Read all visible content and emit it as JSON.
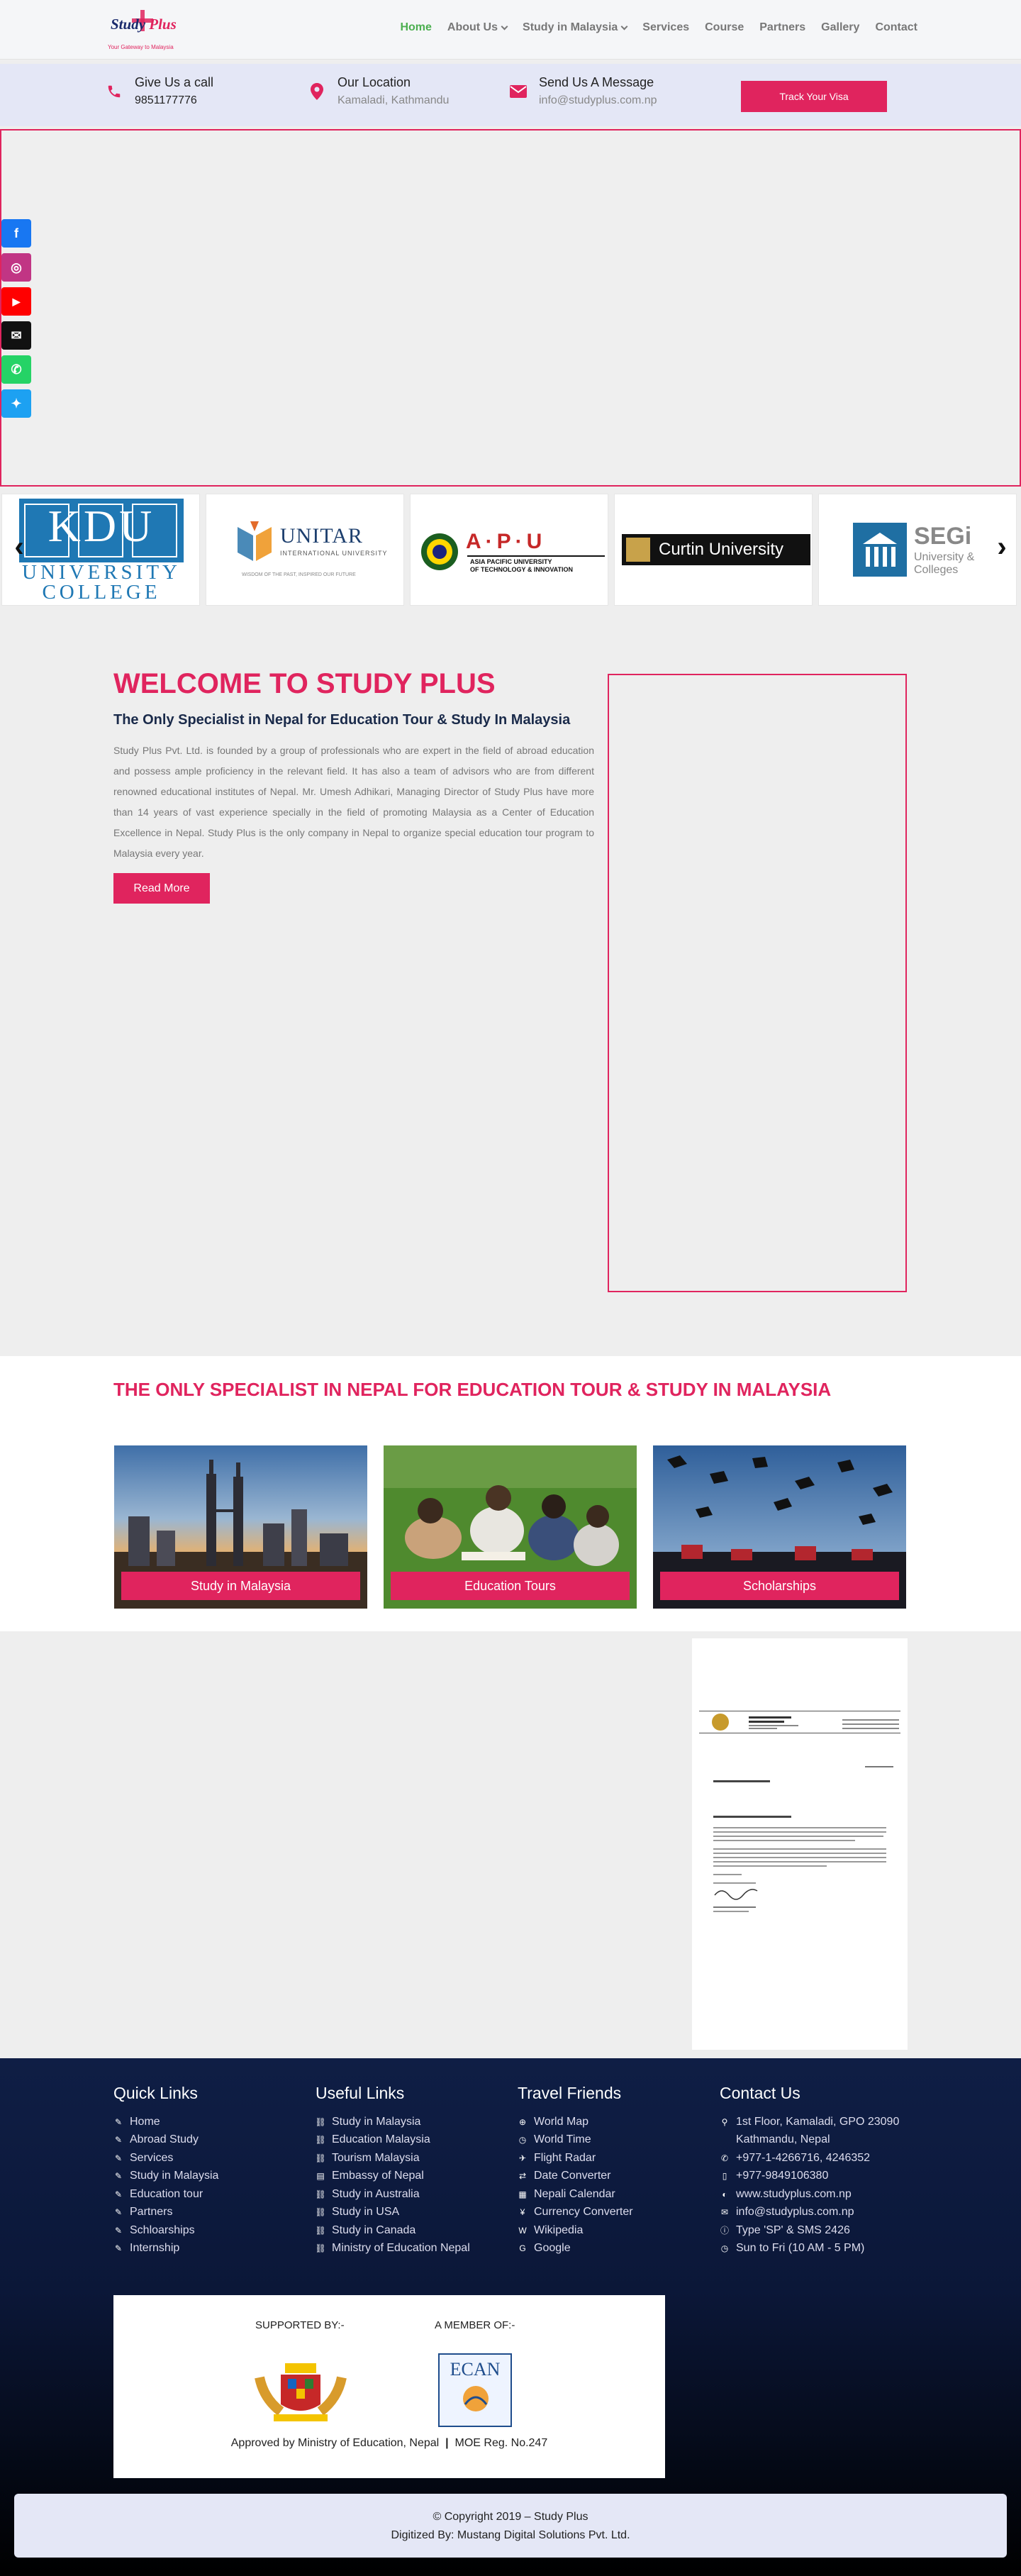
{
  "brand": {
    "name": "Study",
    "name_plus": "Plus",
    "tagline": "Your Gateway to Malaysia"
  },
  "nav": {
    "items": [
      {
        "label": "Home",
        "active": true,
        "dropdown": false
      },
      {
        "label": "About Us",
        "active": false,
        "dropdown": true
      },
      {
        "label": "Study in Malaysia",
        "active": false,
        "dropdown": true
      },
      {
        "label": "Services",
        "active": false,
        "dropdown": false
      },
      {
        "label": "Course",
        "active": false,
        "dropdown": false
      },
      {
        "label": "Partners",
        "active": false,
        "dropdown": false
      },
      {
        "label": "Gallery",
        "active": false,
        "dropdown": false
      },
      {
        "label": "Contact",
        "active": false,
        "dropdown": false
      }
    ]
  },
  "infobar": {
    "call": {
      "title": "Give Us a call",
      "value": "9851177776",
      "icon": "phone-icon"
    },
    "location": {
      "title": "Our Location",
      "value": "Kamaladi, Kathmandu",
      "icon": "map-pin-icon"
    },
    "message": {
      "title": "Send Us A Message",
      "value": "info@studyplus.com.np",
      "icon": "envelope-icon"
    },
    "track_button": "Track Your Visa"
  },
  "social": [
    {
      "name": "facebook-icon",
      "glyph": "f",
      "color": "#1877f2"
    },
    {
      "name": "instagram-icon",
      "glyph": "◎",
      "color": "#c13584"
    },
    {
      "name": "youtube-icon",
      "glyph": "▶",
      "color": "#ff0000"
    },
    {
      "name": "email-icon",
      "glyph": "✉",
      "color": "#111111"
    },
    {
      "name": "whatsapp-icon",
      "glyph": "✆",
      "color": "#25d366"
    },
    {
      "name": "twitter-icon",
      "glyph": "✦",
      "color": "#1da1f2"
    }
  ],
  "partners": {
    "kdu": {
      "letters": "KDU",
      "line1": "UNIVERSITY",
      "line2": "COLLEGE"
    },
    "unitar": {
      "name": "UNITAR",
      "sub": "INTERNATIONAL UNIVERSITY",
      "tag": "WISDOM OF THE PAST, INSPIRED OUR FUTURE"
    },
    "apu": {
      "name": "A·P·U",
      "line1": "ASIA PACIFIC UNIVERSITY",
      "line2": "OF TECHNOLOGY & INNOVATION"
    },
    "curtin": {
      "name": "Curtin University"
    },
    "segi": {
      "name": "SEGi",
      "line1": "University &",
      "line2": "Colleges"
    }
  },
  "welcome": {
    "title": "WELCOME TO STUDY PLUS",
    "subtitle": "The Only Specialist in Nepal for Education Tour & Study In Malaysia",
    "body": "Study Plus Pvt. Ltd. is founded by a group of professionals who are expert in the field of abroad education and possess ample proficiency in the relevant field. It has also a team of advisors who are from different renowned educational institutes of Nepal. Mr. Umesh Adhikari, Managing Director of Study Plus have more than 14 years of vast experience specially in the field of promoting Malaysia as a Center of Education Excellence in Nepal. Study Plus is the only company in Nepal to organize special education tour program to Malaysia every year.",
    "button": "Read More"
  },
  "specialist": {
    "title": "THE ONLY SPECIALIST IN NEPAL FOR EDUCATION TOUR & STUDY IN MALAYSIA",
    "cards": [
      {
        "label": "Study in Malaysia"
      },
      {
        "label": "Education Tours"
      },
      {
        "label": "Scholarships"
      }
    ]
  },
  "letter": {
    "header": "KEDUTAAN BESAR MALAYSIA",
    "header2": "EMBASSY OF MALAYSIA",
    "date": "8 April 2019",
    "to": "TO WHOM IT MAY CONCERN",
    "subject": "GROUNDS PROMOTING EDUCATION IN MALAYSIA"
  },
  "footer": {
    "quick_links": {
      "title": "Quick Links",
      "items": [
        "Home",
        "Abroad Study",
        "Services",
        "Study in Malaysia",
        "Education tour",
        "Partners",
        "Schloarships",
        "Internship"
      ]
    },
    "useful_links": {
      "title": "Useful Links",
      "items": [
        "Study in Malaysia",
        "Education Malaysia",
        "Tourism Malaysia",
        "Embassy of Nepal",
        "Study in Australia",
        "Study in USA",
        "Study in Canada",
        "Ministry of Education Nepal"
      ]
    },
    "travel_friends": {
      "title": "Travel Friends",
      "items": [
        {
          "label": "World Map",
          "icon": "globe-icon",
          "glyph": "⊕"
        },
        {
          "label": "World Time",
          "icon": "clock-icon",
          "glyph": "◷"
        },
        {
          "label": "Flight Radar",
          "icon": "plane-icon",
          "glyph": "✈"
        },
        {
          "label": "Date Converter",
          "icon": "exchange-icon",
          "glyph": "⇄"
        },
        {
          "label": "Nepali Calendar",
          "icon": "calendar-icon",
          "glyph": "▦"
        },
        {
          "label": "Currency Converter",
          "icon": "yen-icon",
          "glyph": "¥"
        },
        {
          "label": "Wikipedia",
          "icon": "wikipedia-icon",
          "glyph": "W"
        },
        {
          "label": "Google",
          "icon": "google-icon",
          "glyph": "G"
        }
      ]
    },
    "contact": {
      "title": "Contact Us",
      "address1": "1st Floor, Kamaladi, GPO 23090",
      "address2": "Kathmandu, Nepal",
      "phone": "+977-1-4266716, 4246352",
      "mobile": " +977-9849106380",
      "web": "www.studyplus.com.np",
      "email": "info@studyplus.com.np",
      "sms": "Type 'SP' & SMS 2426",
      "hours": "Sun to Fri (10 AM - 5 PM)"
    },
    "supported_by": "SUPPORTED BY:-",
    "member_of": "A MEMBER OF:-",
    "ecan": "ECAN",
    "approved": "Approved by Ministry of Education, Nepal",
    "reg": "MOE Reg. No.247",
    "copyright": "© Copyright 2019 – Study Plus",
    "digitized": "Digitized By: Mustang Digital Solutions Pvt. Ltd."
  },
  "colors": {
    "accent": "#e0245e",
    "nav_active": "#4caf50",
    "footer_bg": "#0f1e45",
    "infobar_bg": "#e4e7f6"
  }
}
